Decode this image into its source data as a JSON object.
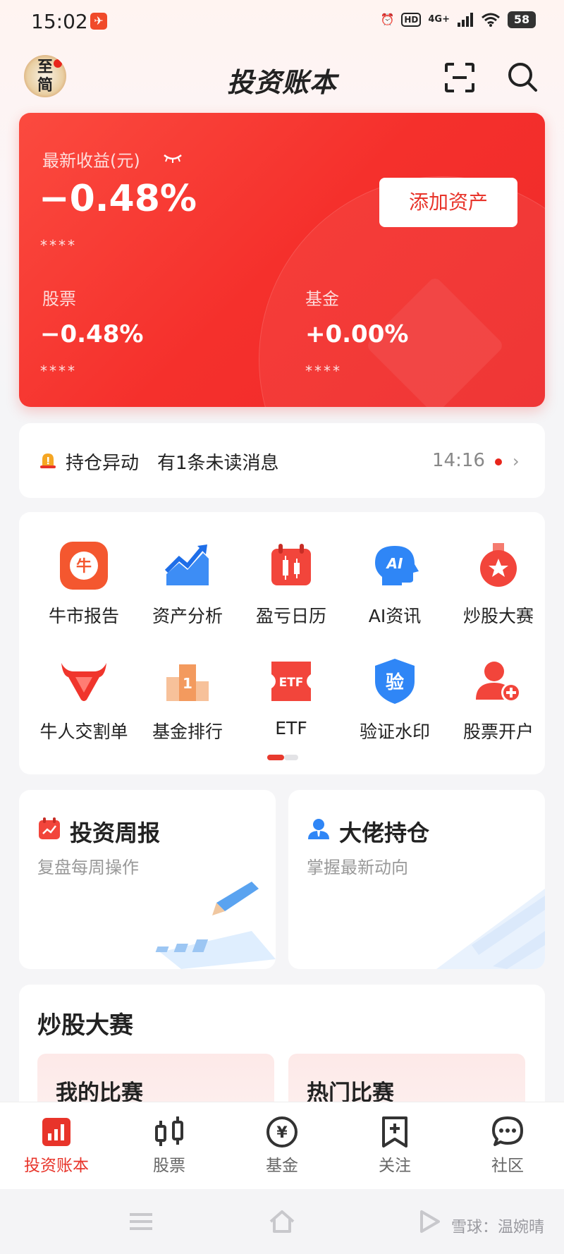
{
  "status_bar": {
    "time": "15:02",
    "app_badge": "✈",
    "alarm": "⏰",
    "hd": "HD",
    "network": "4G+",
    "battery": "58"
  },
  "header": {
    "avatar_text": "至简",
    "title": "投资账本"
  },
  "asset_card": {
    "latest_label": "最新收益(元)",
    "latest_value": "−0.48%",
    "latest_mask": "****",
    "add_button": "添加资产",
    "stock_label": "股票",
    "stock_value": "−0.48%",
    "stock_mask": "****",
    "fund_label": "基金",
    "fund_value": "+0.00%",
    "fund_mask": "****",
    "accent": "#f5302c"
  },
  "alert": {
    "title": "持仓异动",
    "message": "有1条未读消息",
    "time": "14:16"
  },
  "grid": {
    "items": [
      {
        "label": "牛市报告",
        "icon": "bull-report-icon"
      },
      {
        "label": "资产分析",
        "icon": "asset-analysis-icon"
      },
      {
        "label": "盈亏日历",
        "icon": "pnl-calendar-icon"
      },
      {
        "label": "AI资讯",
        "icon": "ai-news-icon"
      },
      {
        "label": "炒股大赛",
        "icon": "contest-medal-icon"
      },
      {
        "label": "牛人交割单",
        "icon": "bull-head-icon"
      },
      {
        "label": "基金排行",
        "icon": "fund-rank-icon"
      },
      {
        "label": "ETF",
        "icon": "etf-ticket-icon"
      },
      {
        "label": "验证水印",
        "icon": "verify-shield-icon"
      },
      {
        "label": "股票开户",
        "icon": "open-account-icon"
      }
    ],
    "ai_glyph": "AI",
    "etf_glyph": "ETF",
    "rank_glyph": "1",
    "verify_glyph": "验",
    "bull_glyph": "牛"
  },
  "features": {
    "weekly_title": "投资周报",
    "weekly_sub": "复盘每周操作",
    "holdings_title": "大佬持仓",
    "holdings_sub": "掌握最新动向"
  },
  "contest": {
    "title": "炒股大赛",
    "mine": "我的比赛",
    "hot": "热门比赛"
  },
  "tabbar": {
    "tabs": [
      {
        "label": "投资账本",
        "icon": "ledger-chart-icon",
        "active": true
      },
      {
        "label": "股票",
        "icon": "candlestick-icon",
        "active": false
      },
      {
        "label": "基金",
        "icon": "yen-circle-icon",
        "active": false
      },
      {
        "label": "关注",
        "icon": "bookmark-plus-icon",
        "active": false
      },
      {
        "label": "社区",
        "icon": "chat-bubble-icon",
        "active": false
      }
    ],
    "yen": "¥"
  },
  "system": {
    "watermark": "雪球：温婉晴"
  }
}
